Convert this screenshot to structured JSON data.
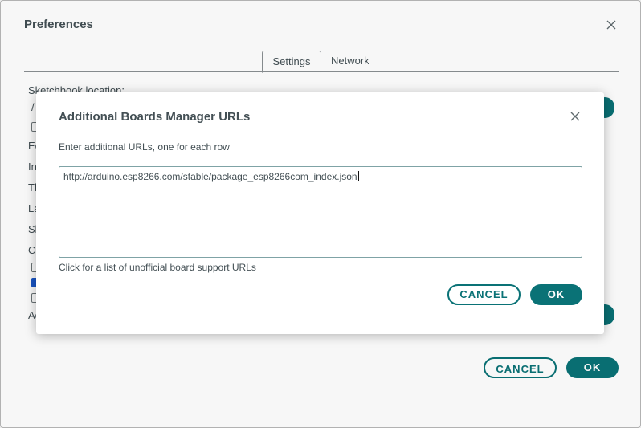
{
  "window": {
    "title": "Preferences"
  },
  "tabs": [
    {
      "label": "Settings"
    },
    {
      "label": "Network"
    }
  ],
  "background": {
    "sketchbook_label": "Sketchbook location:",
    "path_fragment": "/",
    "row_fragments": [
      "Ec",
      "In",
      "Th",
      "La",
      "Sh",
      "Cc",
      "Ac"
    ],
    "cancel_label": "CANCEL",
    "ok_label": "OK"
  },
  "dialog": {
    "title": "Additional Boards Manager URLs",
    "subtitle": "Enter additional URLs, one for each row",
    "urls": "http://arduino.esp8266.com/stable/package_esp8266com_index.json",
    "link_text": "Click for a list of unofficial board support URLs",
    "cancel_label": "CANCEL",
    "ok_label": "OK"
  },
  "icons": {
    "close": "close-icon",
    "check": "check-icon"
  },
  "colors": {
    "accent": "#0a7276",
    "checkbox_checked": "#1a57c8"
  }
}
